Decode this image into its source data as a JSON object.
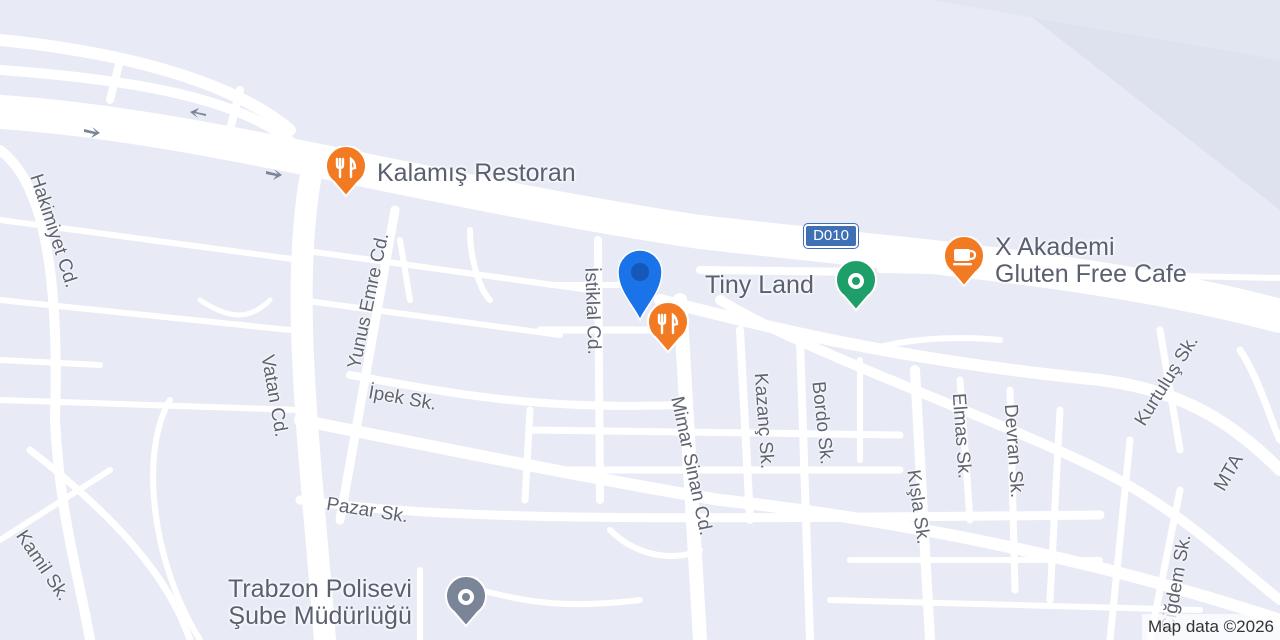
{
  "colors": {
    "background": "#e8ebf5",
    "road": "#ffffff",
    "water": "#dde2ee",
    "restaurant": "#f27a22",
    "park": "#1e9e68",
    "civic": "#7a8598",
    "location": "#1a73e8",
    "highway_shield": "#3f6fb4"
  },
  "highway": {
    "label": "D010"
  },
  "streets": [
    {
      "id": "hakimiyet",
      "label": "Hakimiyet Cd."
    },
    {
      "id": "yunus-emre",
      "label": "Yunus Emre Cd."
    },
    {
      "id": "istiklal",
      "label": "İstiklal Cd."
    },
    {
      "id": "vatan",
      "label": "Vatan Cd."
    },
    {
      "id": "ipek",
      "label": "İpek Sk."
    },
    {
      "id": "mimar-sinan",
      "label": "Mimar Sinan Cd."
    },
    {
      "id": "kazanc",
      "label": "Kazanç Sk."
    },
    {
      "id": "bordo",
      "label": "Bordo Sk."
    },
    {
      "id": "kisla",
      "label": "Kışla Sk."
    },
    {
      "id": "elmas",
      "label": "Elmas Sk."
    },
    {
      "id": "devran",
      "label": "Devran Sk."
    },
    {
      "id": "kurtulus",
      "label": "Kurtuluş Sk."
    },
    {
      "id": "mta",
      "label": "MTA"
    },
    {
      "id": "pazar",
      "label": "Pazar Sk."
    },
    {
      "id": "kamil",
      "label": "Kamil Sk."
    },
    {
      "id": "cigdem",
      "label": "Çiğdem Sk."
    }
  ],
  "places": [
    {
      "id": "kalamis",
      "name": "Kalamış Restoran",
      "icon": "restaurant-icon"
    },
    {
      "id": "x-akademi",
      "name": "X Akademi\nGluten Free Cafe",
      "icon": "cafe-icon"
    },
    {
      "id": "tiny-land",
      "name": "Tiny Land",
      "icon": "park-icon"
    },
    {
      "id": "polisevi",
      "name": "Trabzon Polisevi\nŞube Müdürlüğü",
      "icon": "civic-building-icon"
    },
    {
      "id": "unnamed-restaurant",
      "name": "",
      "icon": "restaurant-icon"
    }
  ],
  "location_marker": {
    "icon": "location-pin-icon"
  },
  "attribution": "Map data ©2026"
}
